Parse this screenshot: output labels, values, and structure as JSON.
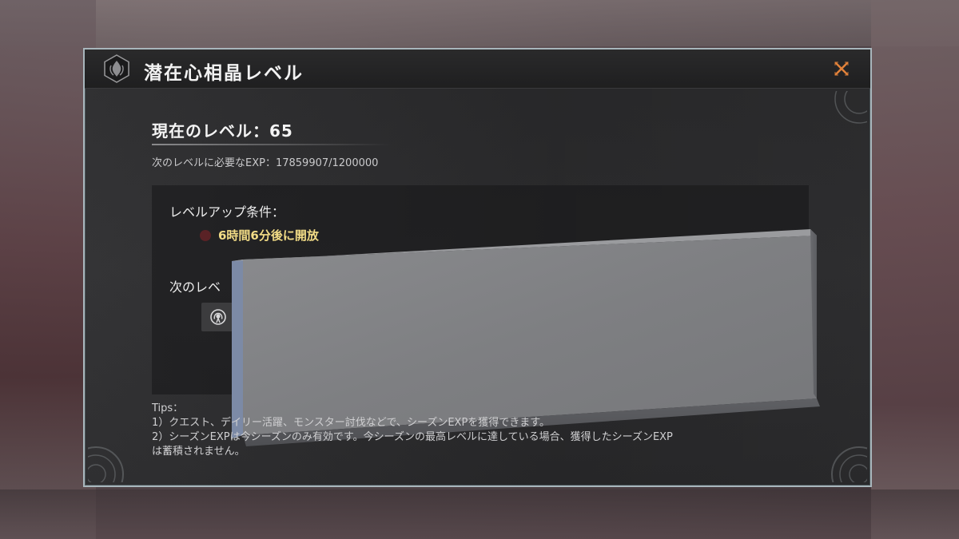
{
  "header": {
    "title": "潜在心相晶レベル",
    "emblem_icon": "flame-crest-icon",
    "close_icon": "close-icon",
    "close_color": "#e2823a"
  },
  "level": {
    "current_label": "現在のレベル：65",
    "exp_label": "次のレベルに必要なEXP：17859907/1200000"
  },
  "conditions": {
    "title": "レベルアップ条件：",
    "unlock_text": "6時間6分後に開放",
    "unlock_color": "#f2dc86"
  },
  "next": {
    "title_partial": "次のレベ",
    "reward_icon": "signal-broadcast-icon"
  },
  "tips": {
    "heading": "Tips：",
    "lines": [
      "1）クエスト、デイリー活躍、モンスター討伐などで、シーズンEXPを獲得できます。",
      "2）シーズンEXPは今シーズンのみ有効です。今シーズンの最高レベルに達している場合、獲得したシーズンEXP",
      "は蓄積されません。"
    ]
  },
  "overlay": {
    "description": "gray-stone-block-occluder"
  }
}
